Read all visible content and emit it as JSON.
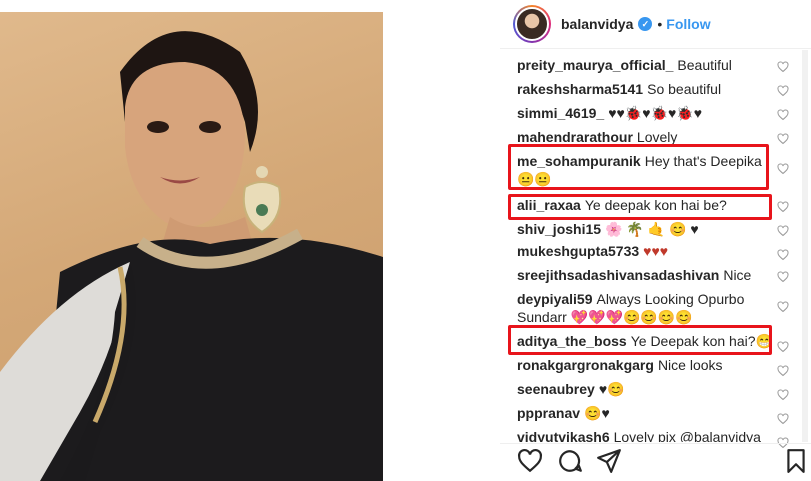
{
  "post": {
    "username": "balanvidya",
    "verified_badge": "✓",
    "separator": "•",
    "follow_label": "Follow"
  },
  "comments": [
    {
      "user": "preity_maurya_official_",
      "text": "Beautiful"
    },
    {
      "user": "rakeshsharma5141",
      "text": "So beautiful"
    },
    {
      "user": "simmi_4619_",
      "text": "♥♥🐞♥🐞♥🐞♥"
    },
    {
      "user": "mahendrarathour",
      "text": "Lovely"
    },
    {
      "user": "me_sohampuranik",
      "text": "Hey that's Deepika",
      "text2": "😐😐"
    },
    {
      "user": "alii_raxaa",
      "text": "Ye deepak kon hai be?"
    },
    {
      "user": "shiv_joshi15",
      "text": "🌸 🌴 🤙 😊 ♥"
    },
    {
      "user": "mukeshgupta5733",
      "text": "♥♥♥"
    },
    {
      "user": "sreejithsadashivansadashivan",
      "text": "Nice"
    },
    {
      "user": "deypiyali59",
      "text": "Always Looking Opurbo",
      "text2": "Sundarr 💖💖💖😊😊😊😊"
    },
    {
      "user": "aditya_the_boss",
      "text": "Ye Deepak kon hai?😁"
    },
    {
      "user": "ronakgargronakgarg",
      "text": "Nice looks"
    },
    {
      "user": "seenaubrey",
      "text": "♥😊"
    },
    {
      "user": "pppranav",
      "text": "😊♥"
    },
    {
      "user": "vidyutvikash6",
      "text": "Lovely pix @balanvidya"
    }
  ],
  "icons": {
    "like": "heart-icon",
    "comment": "comment-icon",
    "share": "share-icon",
    "save": "bookmark-icon"
  },
  "colors": {
    "highlight": "#e8141b",
    "link": "#3897f0",
    "text": "#262626"
  }
}
